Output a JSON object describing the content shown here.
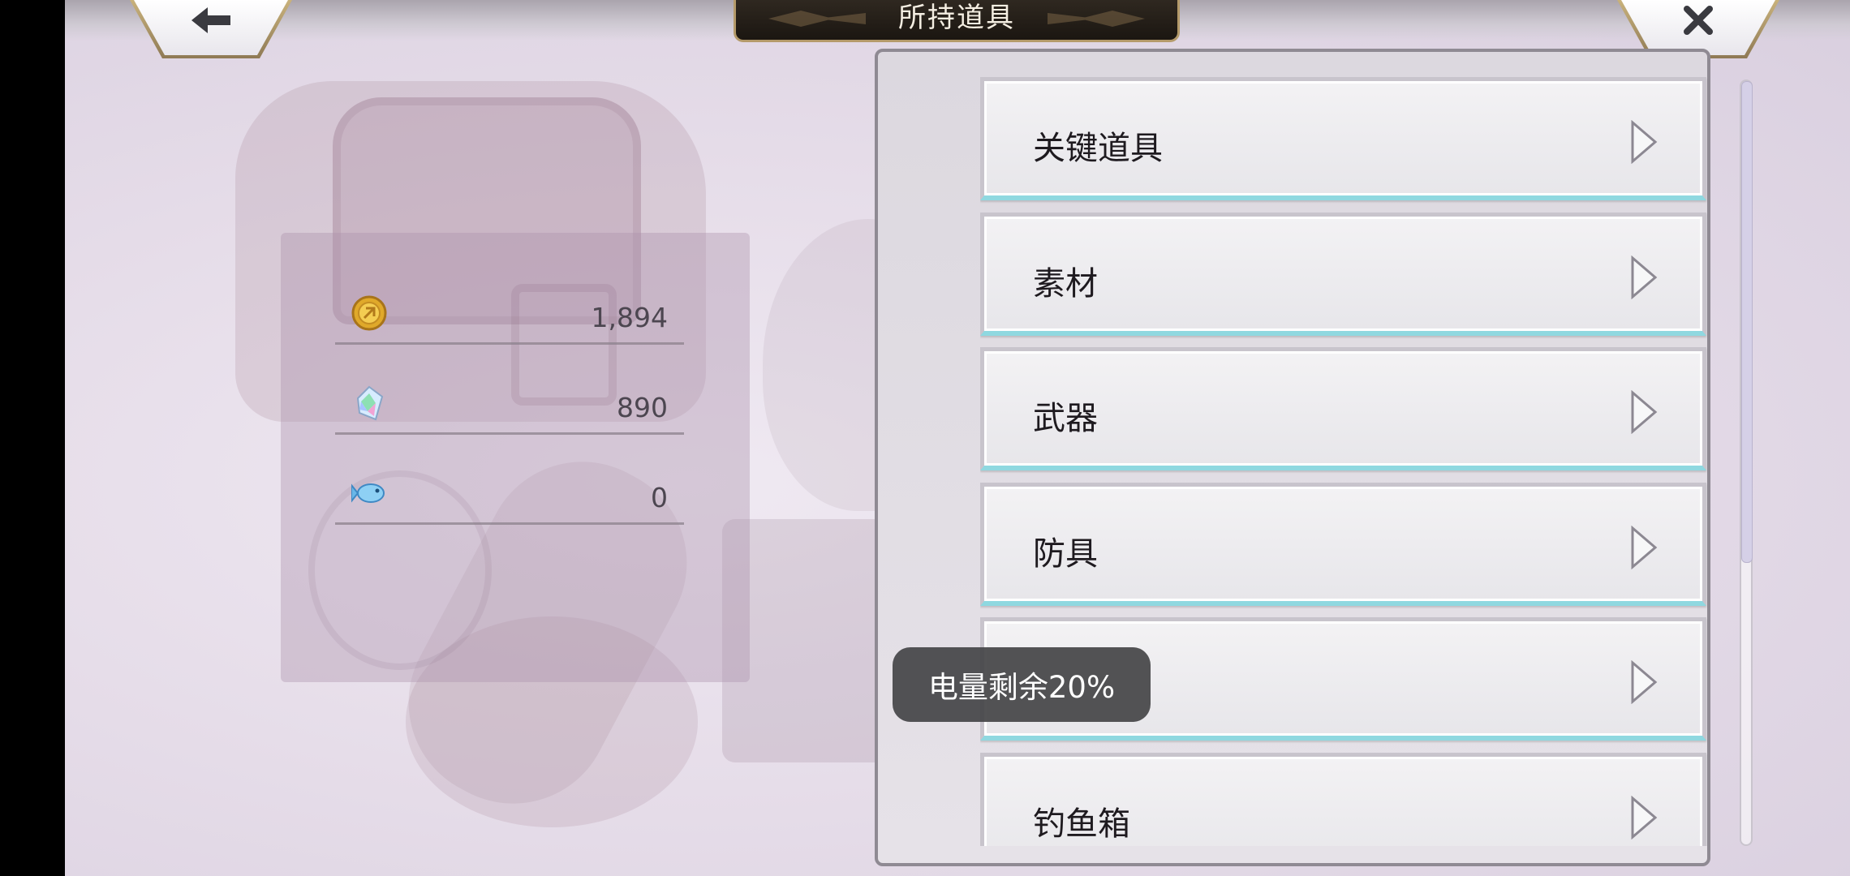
{
  "header": {
    "title": "所持道具",
    "back_icon": "arrow-left-icon",
    "close_icon": "close-icon"
  },
  "currency": {
    "items": [
      {
        "icon": "gold-coin-icon",
        "value": "1,894"
      },
      {
        "icon": "rainbow-crystal-icon",
        "value": "890"
      },
      {
        "icon": "fish-ticket-icon",
        "value": "0"
      }
    ]
  },
  "categories": [
    {
      "label": "关键道具"
    },
    {
      "label": "素材"
    },
    {
      "label": "武器"
    },
    {
      "label": "防具"
    },
    {
      "label": ""
    },
    {
      "label": "钓鱼箱"
    }
  ],
  "toast": {
    "text": "电量剩余20%"
  },
  "colors": {
    "accent_gold": "#b49a6a",
    "title_plate": "#1b1611",
    "item_underline": "#8fd8e0"
  }
}
